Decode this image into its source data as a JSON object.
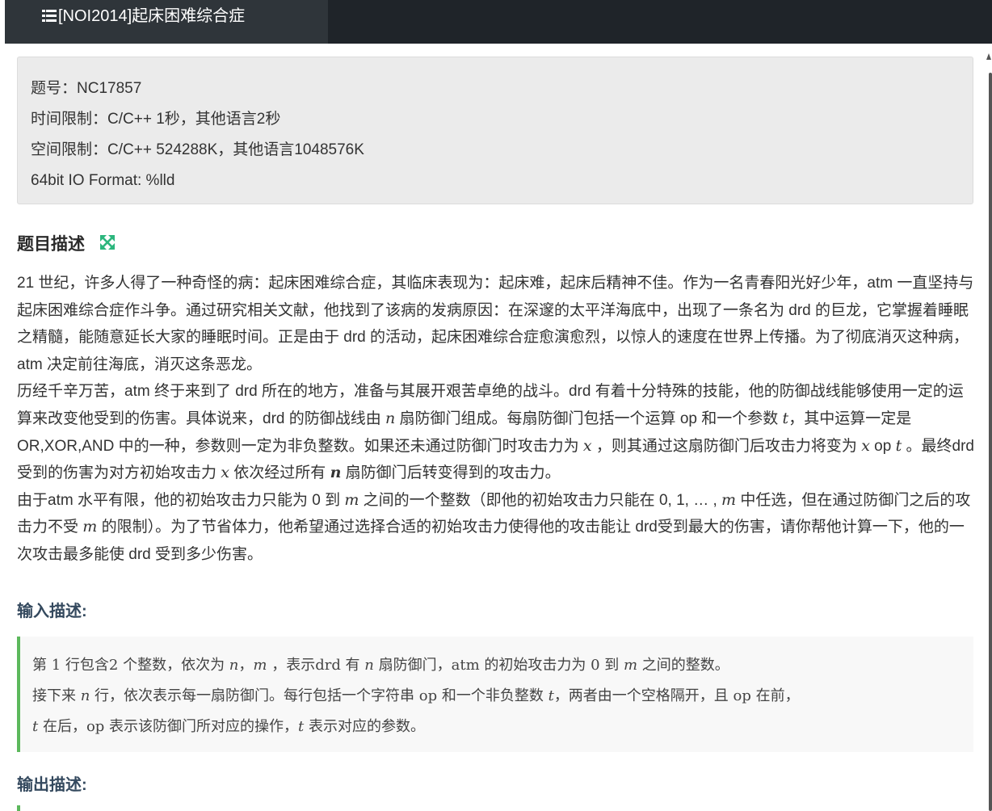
{
  "tab": {
    "title": "[NOI2014]起床困难综合症",
    "icon": "list-icon"
  },
  "info": {
    "lines": [
      "题号：NC17857",
      "时间限制：C/C++ 1秒，其他语言2秒",
      "空间限制：C/C++ 524288K，其他语言1048576K",
      "64bit IO Format: %lld"
    ]
  },
  "description": {
    "title": "题目描述",
    "expand_icon": "expand-arrows-icon",
    "p1": "21 世纪，许多人得了一种奇怪的病：起床困难综合症，其临床表现为：起床难，起床后精神不佳。作为一名青春阳光好少年，atm 一直坚持与起床困难综合症作斗争。通过研究相关文献，他找到了该病的发病原因：在深邃的太平洋海底中，出现了一条名为 drd 的巨龙，它掌握着睡眠之精髓，能随意延长大家的睡眠时间。正是由于 drd 的活动，起床困难综合症愈演愈烈，以惊人的速度在世界上传播。为了彻底消灭这种病，atm 决定前往海底，消灭这条恶龙。",
    "p2": [
      "历经千辛万苦，atm 终于来到了 drd 所在的地方，准备与其展开艰苦卓绝的战斗。drd 有着十分特殊的技能，他的防御战线能够使用一定的运算来改变他受到的伤害。具体说来，drd 的防御战线由 ",
      "n",
      " 扇防御门组成。每扇防御门包括一个运算 op 和一个参数 ",
      "t",
      "，其中运算一定是 OR,XOR,AND 中的一种，参数则一定为非负整数。如果还未通过防御门时攻击力为 ",
      "x",
      " ，则其通过这扇防御门后攻击力将变为 ",
      "x",
      " op ",
      "t",
      " 。最终drd 受到的伤害为对方初始攻击力 ",
      "x",
      " 依次经过所有 ",
      "n",
      " 扇防御门后转变得到的攻击力。"
    ],
    "p3": [
      "由于atm 水平有限，他的初始攻击力只能为 0 到 ",
      "m",
      " 之间的一个整数（即他的初始攻击力只能在 0, 1, … , ",
      "m",
      " 中任选，但在通过防御门之后的攻击力不受 ",
      "m",
      " 的限制）。为了节省体力，他希望通过选择合适的初始攻击力使得他的攻击能让 drd受到最大的伤害，请你帮他计算一下，他的一次攻击最多能使 drd 受到多少伤害。"
    ]
  },
  "input": {
    "title": "输入描述:",
    "line1": [
      "第 1 行包含2 个整数，依次为 ",
      "n",
      "，",
      "m",
      " ，表示drd 有 ",
      "n",
      " 扇防御门，atm 的初始攻击力为 0 到 ",
      "m",
      " 之间的整数。"
    ],
    "line2": [
      "接下来 ",
      "n",
      " 行，依次表示每一扇防御门。每行包括一个字符串 op 和一个非负整数 ",
      "t",
      "，两者由一个空格隔开，且 op 在前，"
    ],
    "line3": [
      "t",
      " 在后，op 表示该防御门所对应的操作，",
      "t",
      " 表示对应的参数。"
    ]
  },
  "output": {
    "title": "输出描述:"
  },
  "colors": {
    "topbar": "#1f2429",
    "tab": "#2f353a",
    "accent_green": "#5cb85c",
    "info_bg": "#ebebeb"
  }
}
